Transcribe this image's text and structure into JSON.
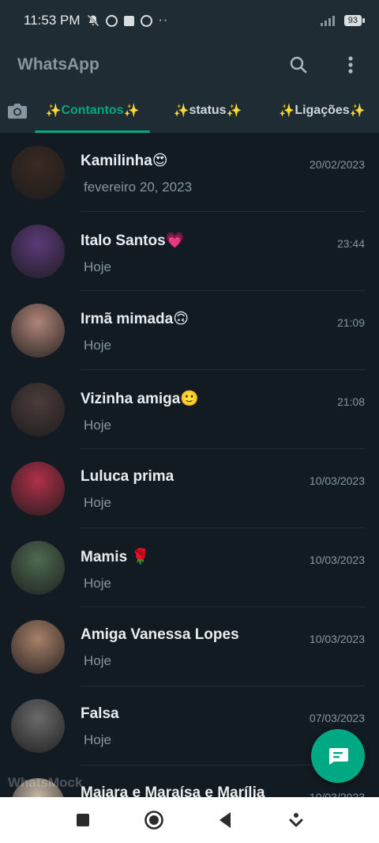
{
  "status_bar": {
    "time": "11:53 PM",
    "extra": "··",
    "battery": "93"
  },
  "app_bar": {
    "title": "WhatsApp",
    "search_icon": "search-icon",
    "menu_icon": "more-vert-icon"
  },
  "tabs": [
    {
      "label": "Contantos",
      "prefix": "✨",
      "suffix": "✨",
      "active": true
    },
    {
      "label": "status ",
      "prefix": "✨",
      "suffix": "✨",
      "active": false
    },
    {
      "label": "Ligações",
      "prefix": "✨",
      "suffix": "✨",
      "active": false
    }
  ],
  "chats": [
    {
      "name": "Kamilinha😍",
      "preview": "fevereiro 20, 2023",
      "time": "20/02/2023",
      "avatar_color": "#3a2a22"
    },
    {
      "name": "Italo Santos💗",
      "preview": "Hoje",
      "time": "23:44",
      "avatar_color": "#5b3a7a"
    },
    {
      "name": "Irmã mimada🙃",
      "preview": "Hoje",
      "time": "21:09",
      "avatar_color": "#b08478"
    },
    {
      "name": "Vizinha amiga🙂",
      "preview": "Hoje",
      "time": "21:08",
      "avatar_color": "#4a3c3a"
    },
    {
      "name": "Luluca prima",
      "preview": "Hoje",
      "time": "10/03/2023",
      "avatar_color": "#b0304a"
    },
    {
      "name": "Mamis 🌹",
      "preview": "Hoje",
      "time": "10/03/2023",
      "avatar_color": "#4e6a52"
    },
    {
      "name": "Amiga Vanessa Lopes",
      "preview": "Hoje",
      "time": "10/03/2023",
      "avatar_color": "#a88068"
    },
    {
      "name": "Falsa",
      "preview": "Hoje",
      "time": "07/03/2023",
      "avatar_color": "#6a6a6a"
    },
    {
      "name": "Maiara e Maraísa e Marília",
      "preview": "",
      "time": "10/03/2023",
      "avatar_color": "#c8b8a8"
    }
  ],
  "watermark": "WhatsMock",
  "fab_icon": "new-chat-icon",
  "colors": {
    "accent": "#00a884",
    "background": "#121b22",
    "header": "#1f2c34"
  }
}
